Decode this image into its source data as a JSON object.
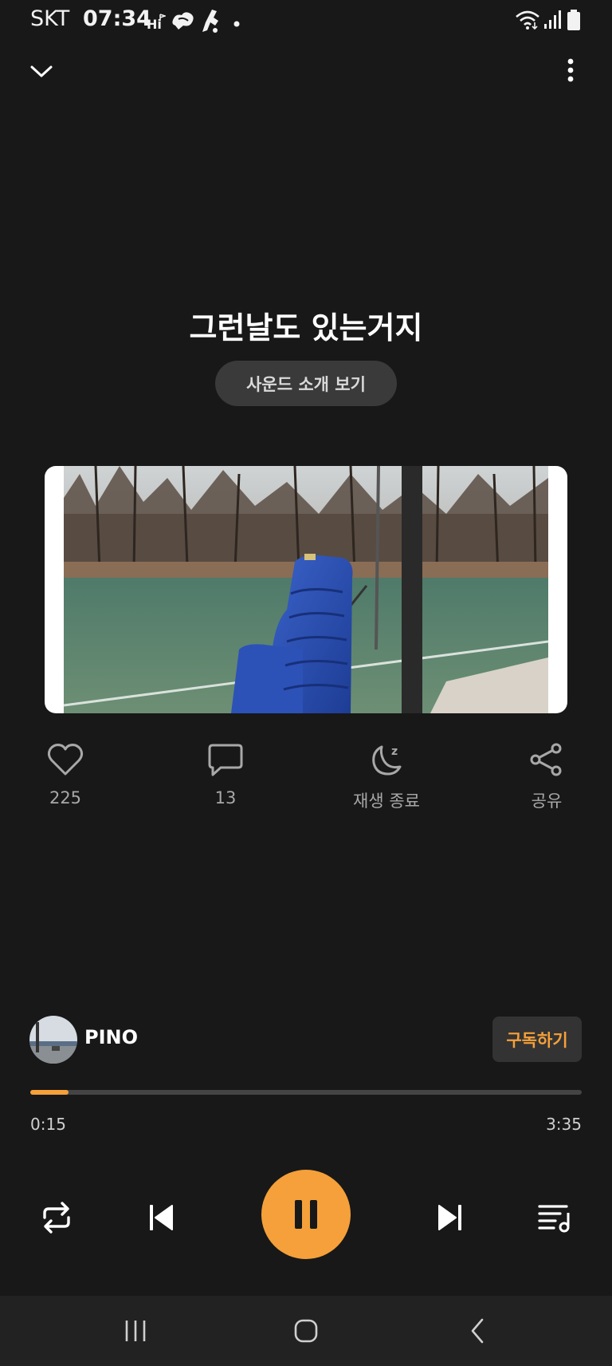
{
  "status_bar": {
    "carrier": "SKT",
    "time": "07:34",
    "icons": [
      "hi-flag-icon",
      "cloud-notification-icon",
      "running-app-icon",
      "dot-icon",
      "wifi-icon",
      "signal-icon",
      "battery-icon"
    ]
  },
  "header": {
    "collapse_icon": "chevron-down-icon",
    "more_icon": "more-vertical-icon"
  },
  "track": {
    "title": "그런날도 있는거지",
    "intro_button": "사운드 소개 보기"
  },
  "actions": [
    {
      "icon": "heart-icon",
      "label": "225"
    },
    {
      "icon": "comment-icon",
      "label": "13"
    },
    {
      "icon": "sleep-timer-icon",
      "label": "재생 종료"
    },
    {
      "icon": "share-icon",
      "label": "공유"
    }
  ],
  "artist": {
    "name": "PINO",
    "subscribe_label": "구독하기"
  },
  "playback": {
    "current_time": "0:15",
    "total_time": "3:35",
    "progress": 0.07
  },
  "controls": [
    "repeat-icon",
    "previous-icon",
    "pause-icon",
    "next-icon",
    "playlist-icon"
  ],
  "colors": {
    "background": "#181818",
    "accent": "#f5a03a",
    "muted_text": "#a8a8a8",
    "button_bg": "#3a3a3a"
  },
  "nav_bar": [
    "recent-apps-icon",
    "home-icon",
    "back-icon"
  ]
}
